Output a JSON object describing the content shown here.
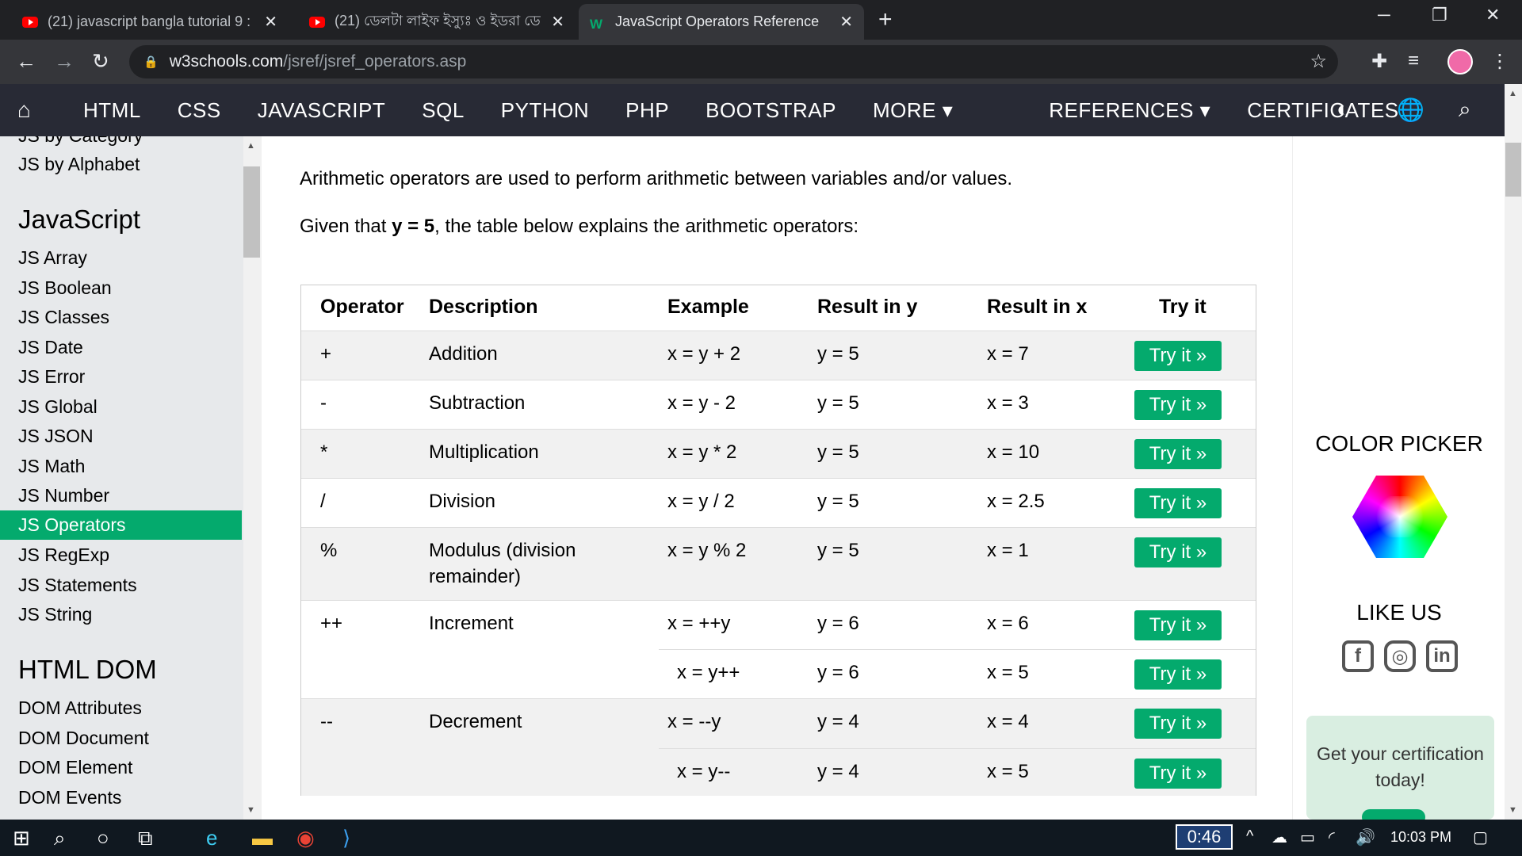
{
  "browser": {
    "tabs": [
      {
        "title": "(21) javascript bangla tutorial 9 : ",
        "icon": "youtube-icon"
      },
      {
        "title": "(21) ডেলটা লাইফ ইস্যুঃ ও ইডরা ডে",
        "icon": "youtube-icon"
      },
      {
        "title": "JavaScript Operators Reference",
        "icon": "w3schools-icon"
      }
    ],
    "url_host": "w3schools.com",
    "url_path": "/jsref/jsref_operators.asp"
  },
  "w3nav": {
    "items": [
      "HTML",
      "CSS",
      "JAVASCRIPT",
      "SQL",
      "PYTHON",
      "PHP",
      "BOOTSTRAP",
      "MORE ▾"
    ],
    "right_items": [
      "REFERENCES ▾",
      "CERTIFICATES"
    ]
  },
  "sidebar": {
    "top_items": [
      "JS by Category",
      "JS by Alphabet"
    ],
    "heading_js": "JavaScript",
    "js_items": [
      "JS Array",
      "JS Boolean",
      "JS Classes",
      "JS Date",
      "JS Error",
      "JS Global",
      "JS JSON",
      "JS Math",
      "JS Number",
      "JS Operators",
      "JS RegExp",
      "JS Statements",
      "JS String"
    ],
    "active_item": "JS Operators",
    "heading_dom": "HTML DOM",
    "dom_items": [
      "DOM Attributes",
      "DOM Document",
      "DOM Element",
      "DOM Events"
    ]
  },
  "main": {
    "intro": "Arithmetic operators are used to perform arithmetic between variables and/or values.",
    "given_prefix": "Given that ",
    "given_bold": "y = 5",
    "given_suffix": ", the table below explains the arithmetic operators:",
    "table": {
      "headers": [
        "Operator",
        "Description",
        "Example",
        "Result in y",
        "Result in x",
        "Try it"
      ],
      "rows": [
        {
          "operator": "+",
          "description": "Addition",
          "example": "x = y + 2",
          "result_y": "y = 5",
          "result_x": "x = 7",
          "try": "Try it »"
        },
        {
          "operator": "-",
          "description": "Subtraction",
          "example": "x = y - 2",
          "result_y": "y = 5",
          "result_x": "x = 3",
          "try": "Try it »"
        },
        {
          "operator": "*",
          "description": "Multiplication",
          "example": "x = y * 2",
          "result_y": "y = 5",
          "result_x": "x = 10",
          "try": "Try it »"
        },
        {
          "operator": "/",
          "description": "Division",
          "example": "x = y / 2",
          "result_y": "y = 5",
          "result_x": "x = 2.5",
          "try": "Try it »"
        },
        {
          "operator": "%",
          "description": "Modulus (division remainder)",
          "example": "x = y % 2",
          "result_y": "y = 5",
          "result_x": "x = 1",
          "try": "Try it »"
        },
        {
          "operator": "++",
          "description": "Increment",
          "example": "x = ++y",
          "result_y": "y = 6",
          "result_x": "x = 6",
          "try": "Try it »"
        },
        {
          "operator": "",
          "description": "",
          "example": "x = y++",
          "result_y": "y = 6",
          "result_x": "x = 5",
          "try": "Try it »"
        },
        {
          "operator": "--",
          "description": "Decrement",
          "example": "x = --y",
          "result_y": "y = 4",
          "result_x": "x = 4",
          "try": "Try it »"
        },
        {
          "operator": "",
          "description": "",
          "example": "x = y--",
          "result_y": "y = 4",
          "result_x": "x = 5",
          "try": "Try it »"
        }
      ]
    }
  },
  "right_panel": {
    "color_picker": "COLOR PICKER",
    "like_us": "LIKE US",
    "cert_text": "Get your certification today!"
  },
  "taskbar": {
    "timer": "0:46",
    "clock": "10:03 PM"
  },
  "colors": {
    "w3_green": "#04aa6d",
    "w3_nav": "#282a35"
  }
}
